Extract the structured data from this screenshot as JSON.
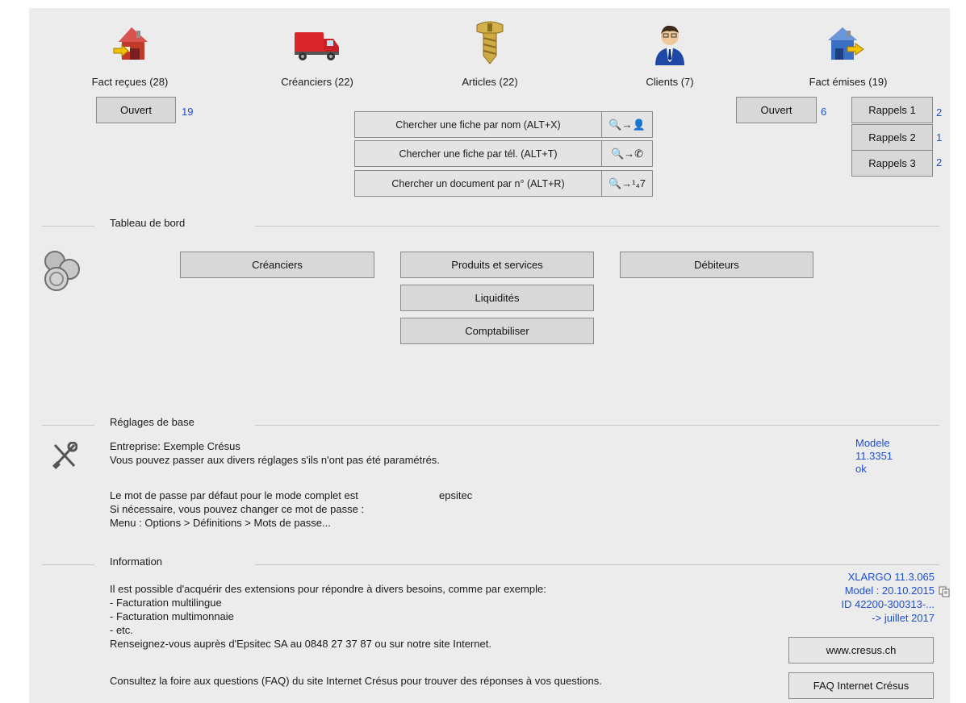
{
  "top_icons": {
    "fact_recues": {
      "label": "Fact reçues (28)"
    },
    "creanciers": {
      "label": "Créanciers (22)"
    },
    "articles": {
      "label": "Articles (22)"
    },
    "clients": {
      "label": "Clients (7)"
    },
    "fact_emises": {
      "label": "Fact émises (19)"
    }
  },
  "fact_recues_open": {
    "label": "Ouvert",
    "count": "19"
  },
  "fact_emises_open": {
    "label": "Ouvert",
    "count": "6"
  },
  "search": {
    "by_name": {
      "label": "Chercher une fiche par nom (ALT+X)",
      "icon": "🔍→👤"
    },
    "by_phone": {
      "label": "Chercher une fiche par tél. (ALT+T)",
      "icon": "🔍→✆"
    },
    "by_number": {
      "label": "Chercher un document par n° (ALT+R)",
      "icon": "🔍→¹₄7"
    }
  },
  "rappels": [
    {
      "label": "Rappels 1",
      "count": "2"
    },
    {
      "label": "Rappels 2",
      "count": "1"
    },
    {
      "label": "Rappels 3",
      "count": "2"
    }
  ],
  "dashboard": {
    "title": "Tableau de bord",
    "creanciers": "Créanciers",
    "produits": "Produits et services",
    "debiteurs": "Débiteurs",
    "liquidites": "Liquidités",
    "comptabiliser": "Comptabiliser"
  },
  "reglages": {
    "title": "Réglages de base",
    "line1": "Entreprise: Exemple Crésus",
    "line2": "Vous pouvez passer aux divers réglages s'ils n'ont pas été paramétrés.",
    "line3": "Le mot de passe par défaut pour le mode complet est",
    "password": "epsitec",
    "line4": "Si nécessaire, vous pouvez changer ce mot de passe :",
    "line5": "Menu : Options > Définitions > Mots de passe...",
    "model_lines": [
      "Modele",
      "11.3351",
      "ok"
    ]
  },
  "information": {
    "title": "Information",
    "lines": [
      "Il est possible d'acquérir des extensions pour répondre à divers besoins, comme par exemple:",
      "- Facturation multilingue",
      "- Facturation multimonnaie",
      "- etc.",
      "Renseignez-vous auprès d'Epsitec SA au 0848 27 37 87 ou sur notre site Internet."
    ],
    "faq_text": "Consultez la foire aux questions (FAQ) du site Internet Crésus pour trouver des réponses à vos questions.",
    "version_lines": [
      "XLARGO 11.3.065",
      "Model : 20.10.2015",
      "ID  42200-300313-...",
      "-> juillet 2017"
    ],
    "www_button": "www.cresus.ch",
    "faq_button": "FAQ Internet Crésus"
  },
  "colors": {
    "link": "#1f4fd1",
    "panel": "#ececec",
    "button": "#d8d8d8"
  }
}
